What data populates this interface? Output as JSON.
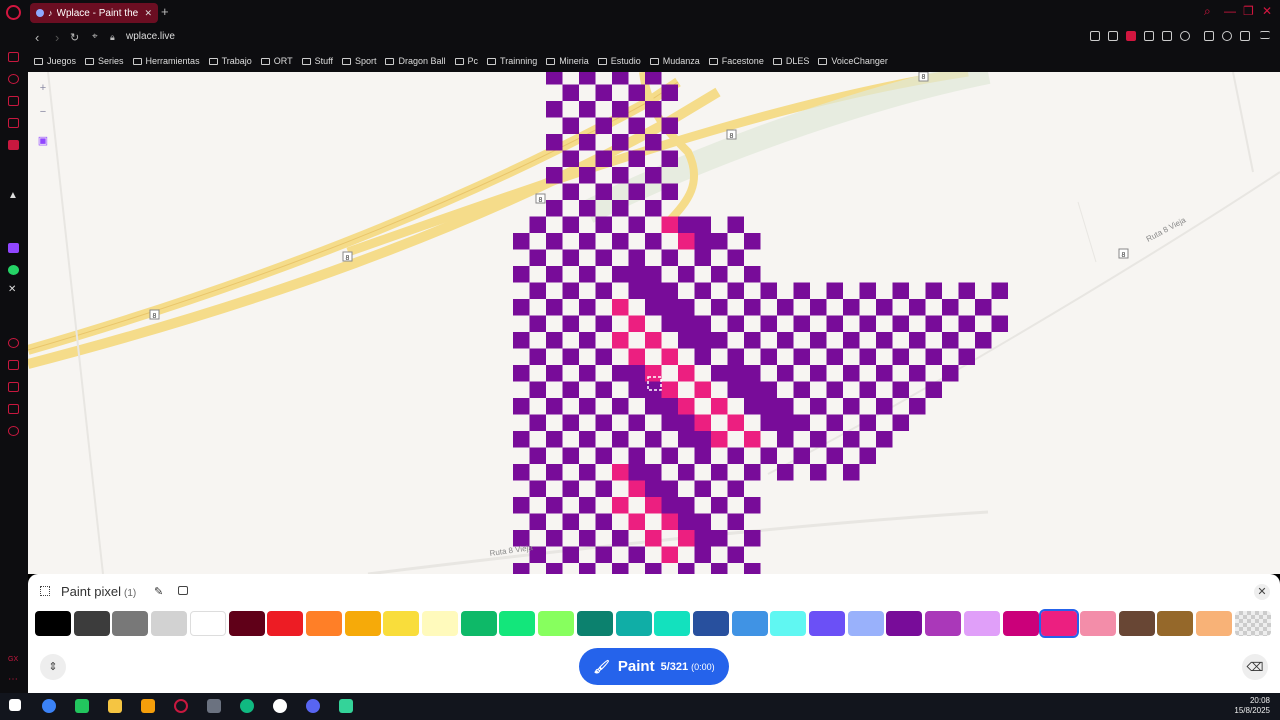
{
  "browser": {
    "tab_title": "Wplace - Paint the wor",
    "url": "wplace.live",
    "bookmarks": [
      "Juegos",
      "Series",
      "Herramientas",
      "Trabajo",
      "ORT",
      "Stuff",
      "Sport",
      "Dragon Ball",
      "Pc",
      "Trainning",
      "Mineria",
      "Estudio",
      "Mudanza",
      "Facestone",
      "DLES",
      "VoiceChanger"
    ]
  },
  "map": {
    "labels": {
      "road_ruta8_vieja_right": "Ruta 8 Vieja",
      "road_ruta8_vieja_bottom": "Ruta 8 Vieja",
      "shield": "8"
    },
    "controls": {
      "zoom_in": "+",
      "zoom_out": "−"
    }
  },
  "panel": {
    "title": "Paint pixel",
    "count": "(1)",
    "colors": [
      "#000000",
      "#3c3c3c",
      "#787878",
      "#d2d2d2",
      "#ffffff",
      "#600018",
      "#ed1c24",
      "#ff7f27",
      "#f6aa09",
      "#f9dd3b",
      "#fffabc",
      "#0eb968",
      "#13e67b",
      "#87ff5e",
      "#0c816e",
      "#10aea6",
      "#13e1be",
      "#28509e",
      "#4093e4",
      "#60f7f2",
      "#6b50f6",
      "#99b1fb",
      "#780c99",
      "#aa38b9",
      "#e09ff9",
      "#cb007a",
      "#ec1f80",
      "#f38da9",
      "#684634",
      "#95682a",
      "#f8b277",
      "transparent"
    ],
    "selected_color_index": 26,
    "paint_button": {
      "label": "Paint",
      "count": "5/321",
      "timer": "(0:00)"
    }
  },
  "taskbar": {
    "time": "20:08",
    "date": "15/8/2025"
  }
}
